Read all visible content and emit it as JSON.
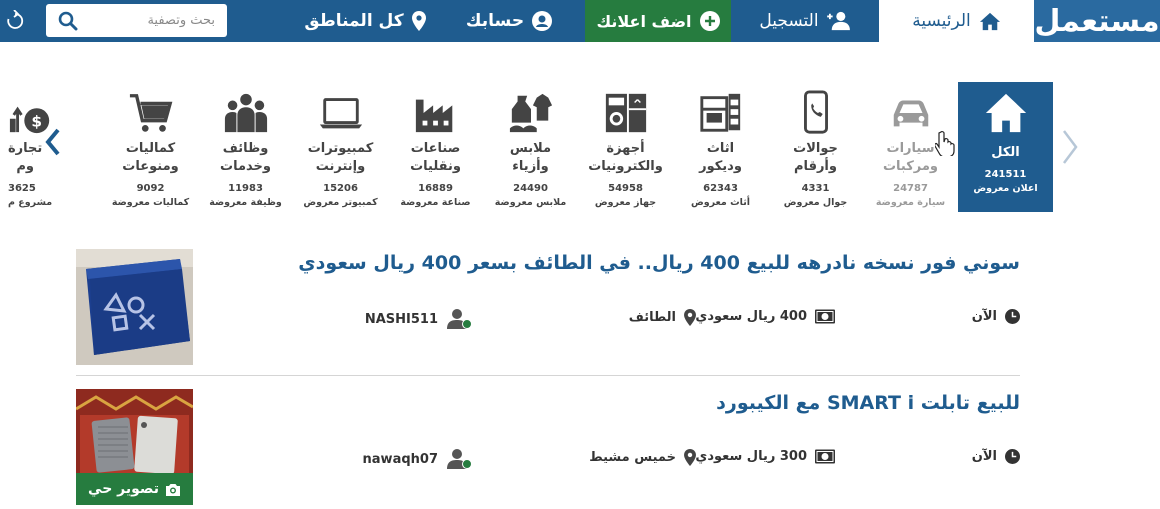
{
  "nav": {
    "logo": "مستعمل",
    "home": "الرئيسية",
    "register": "التسجيل",
    "add_ad": "اضف اعلانك",
    "account": "حسابك",
    "regions": "كل المناطق",
    "search_placeholder": "بحث وتصفية"
  },
  "categories": [
    {
      "name": "الكل",
      "count": "241511",
      "sub": "اعلان معروض",
      "icon": "home-icon"
    },
    {
      "name": "سيارات ومركبات",
      "count": "24787",
      "sub": "سيارة معروضة",
      "icon": "car-icon"
    },
    {
      "name": "جوالات وأرقام",
      "count": "4331",
      "sub": "جوال معروض",
      "icon": "phone-icon"
    },
    {
      "name": "اثاث وديكور",
      "count": "62343",
      "sub": "أثاث معروض",
      "icon": "furniture-icon"
    },
    {
      "name": "أجهزة والكترونيات",
      "count": "54958",
      "sub": "جهاز معروض",
      "icon": "appliances-icon"
    },
    {
      "name": "ملابس وأزياء",
      "count": "24490",
      "sub": "ملابس معروضة",
      "icon": "clothes-icon"
    },
    {
      "name": "صناعات ونقليات",
      "count": "16889",
      "sub": "صناعة معروضة",
      "icon": "factory-icon"
    },
    {
      "name": "كمبيوترات وإنترنت",
      "count": "15206",
      "sub": "كمبيوتر معروض",
      "icon": "laptop-icon"
    },
    {
      "name": "وظائف وخدمات",
      "count": "11983",
      "sub": "وظيفة معروضة",
      "icon": "people-icon"
    },
    {
      "name": "كماليات ومنوعات",
      "count": "9092",
      "sub": "كماليات معروضة",
      "icon": "cart-icon"
    },
    {
      "name": "تجارة وم",
      "count": "3625",
      "sub": "مشروع م",
      "icon": "money-icon"
    }
  ],
  "listings": [
    {
      "title": "سوني فور نسخه نادرهه للبيع 400 ريال.. في الطائف بسعر 400 ريال سعودي",
      "time": "الآن",
      "price": "400 ريال سعودي",
      "city": "الطائف",
      "user": "NASHI511"
    },
    {
      "title": "للبيع تابلت SMART i مع الكيبورد",
      "time": "الآن",
      "price": "300 ريال سعودي",
      "city": "خميس مشيط",
      "user": "nawaqh07",
      "badge": "تصوير حي"
    }
  ],
  "colors": {
    "brand_blue": "#1f5c8f",
    "green": "#267c3f"
  }
}
